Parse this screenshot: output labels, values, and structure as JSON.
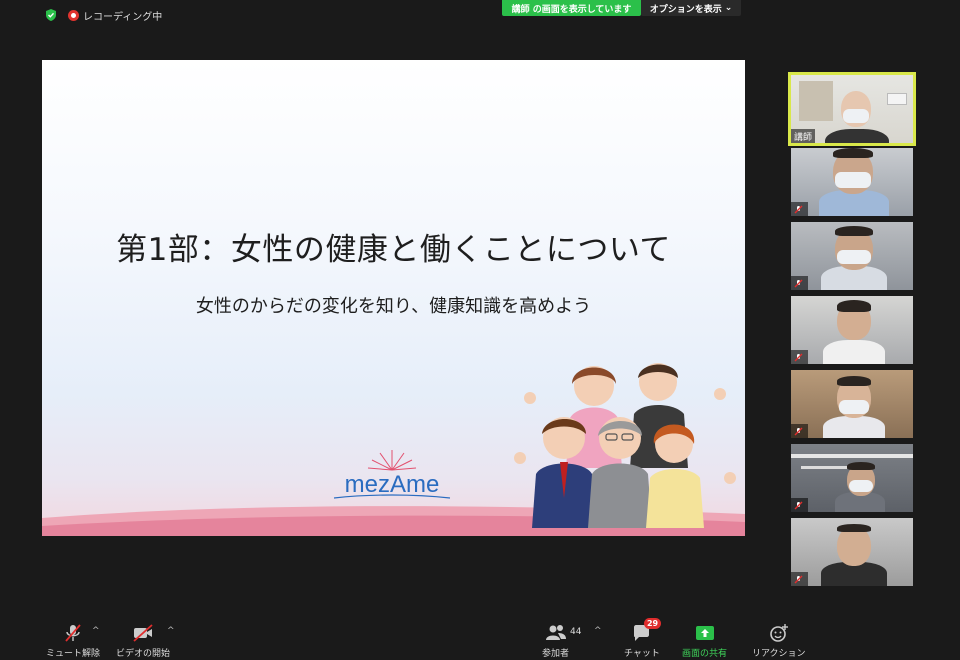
{
  "topbar": {
    "recording_label": "レコーディング中",
    "share_banner": "講師 の画面を表示しています",
    "options_label": "オプションを表示",
    "options_caret": "⌄"
  },
  "slide": {
    "title": "第1部：女性の健康と働くことについて",
    "subtitle": "女性のからだの変化を知り、健康知識を高めよう",
    "logo_text": "mezAme"
  },
  "participants": [
    {
      "name": "講師",
      "active": true
    },
    {
      "name": "",
      "active": false
    },
    {
      "name": "",
      "active": false
    },
    {
      "name": "",
      "active": false
    },
    {
      "name": "",
      "active": false
    },
    {
      "name": "",
      "active": false
    },
    {
      "name": "",
      "active": false
    }
  ],
  "toolbar": {
    "mute_label": "ミュート解除",
    "video_label": "ビデオの開始",
    "participants_label": "参加者",
    "participants_count": "44",
    "chat_label": "チャット",
    "chat_badge": "29",
    "share_label": "画面の共有",
    "reaction_label": "リアクション",
    "caret": "^"
  },
  "colors": {
    "share_green": "#2bc04a",
    "active_border": "#d9e84a",
    "badge_red": "#e02d2d"
  }
}
